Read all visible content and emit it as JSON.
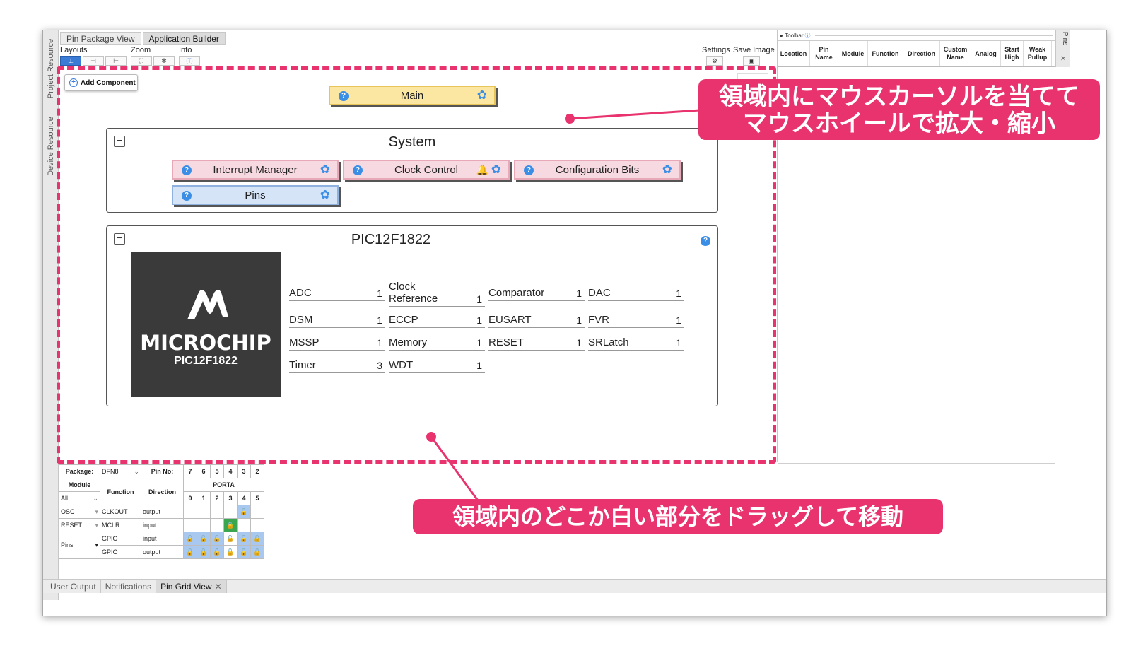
{
  "tabs_top": [
    "Pin Package View",
    "Application Builder"
  ],
  "rail_tabs": [
    "Project Resource",
    "Device Resource"
  ],
  "toolbar": {
    "layouts_label": "Layouts",
    "zoom_label": "Zoom",
    "info_label": "Info",
    "settings_label": "Settings",
    "save_image_label": "Save Image"
  },
  "canvas": {
    "add_component": "Add Component",
    "main_node": "Main",
    "system_group": {
      "title": "System",
      "nodes": [
        "Interrupt Manager",
        "Clock Control",
        "Configuration Bits",
        "Pins"
      ]
    },
    "device_group": {
      "title": "PIC12F1822",
      "logo_brand": "MICROCHIP",
      "logo_part": "PIC12F1822",
      "modules": [
        {
          "name": "ADC",
          "count": "1"
        },
        {
          "name": "Clock Reference",
          "count": "1"
        },
        {
          "name": "Comparator",
          "count": "1"
        },
        {
          "name": "DAC",
          "count": "1"
        },
        {
          "name": "DSM",
          "count": "1"
        },
        {
          "name": "ECCP",
          "count": "1"
        },
        {
          "name": "EUSART",
          "count": "1"
        },
        {
          "name": "FVR",
          "count": "1"
        },
        {
          "name": "MSSP",
          "count": "1"
        },
        {
          "name": "Memory",
          "count": "1"
        },
        {
          "name": "RESET",
          "count": "1"
        },
        {
          "name": "SRLatch",
          "count": "1"
        },
        {
          "name": "Timer",
          "count": "3"
        },
        {
          "name": "WDT",
          "count": "1"
        }
      ]
    }
  },
  "right_panel": {
    "toolbar_label": "Toolbar",
    "side_tab": "Pins",
    "columns": [
      "Location",
      "Pin Name",
      "Module",
      "Function",
      "Direction",
      "Custom Name",
      "Analog",
      "Start High",
      "Weak Pullup"
    ]
  },
  "pin_grid": {
    "package_label": "Package:",
    "package_value": "DFN8",
    "pin_no_label": "Pin No:",
    "pin_numbers": [
      "7",
      "6",
      "5",
      "4",
      "3",
      "2"
    ],
    "module_header": "Module",
    "function_header": "Function",
    "direction_header": "Direction",
    "port_header": "PORTA",
    "bits": [
      "0",
      "1",
      "2",
      "3",
      "4",
      "5"
    ],
    "filter_value": "All",
    "rows": [
      {
        "module": "OSC",
        "function": "CLKOUT",
        "direction": "output"
      },
      {
        "module": "RESET",
        "function": "MCLR",
        "direction": "input"
      },
      {
        "module": "Pins",
        "function": "GPIO",
        "direction": "input"
      },
      {
        "module": "",
        "function": "GPIO",
        "direction": "output"
      }
    ]
  },
  "tabs_bottom": [
    "User Output",
    "Notifications",
    "Pin Grid View"
  ],
  "callouts": {
    "zoom_line1": "領域内にマウスカーソルを当てて",
    "zoom_line2": "マウスホイールで拡大・縮小",
    "drag": "領域内のどこか白い部分をドラッグして移動"
  },
  "colors": {
    "accent": "#e8336e",
    "main_node": "#fbe7a1",
    "system_node": "#f7d9e1",
    "pins_node": "#d6e4f7",
    "help_icon": "#3a8ee6",
    "chip_bg": "#3a3a3a"
  }
}
